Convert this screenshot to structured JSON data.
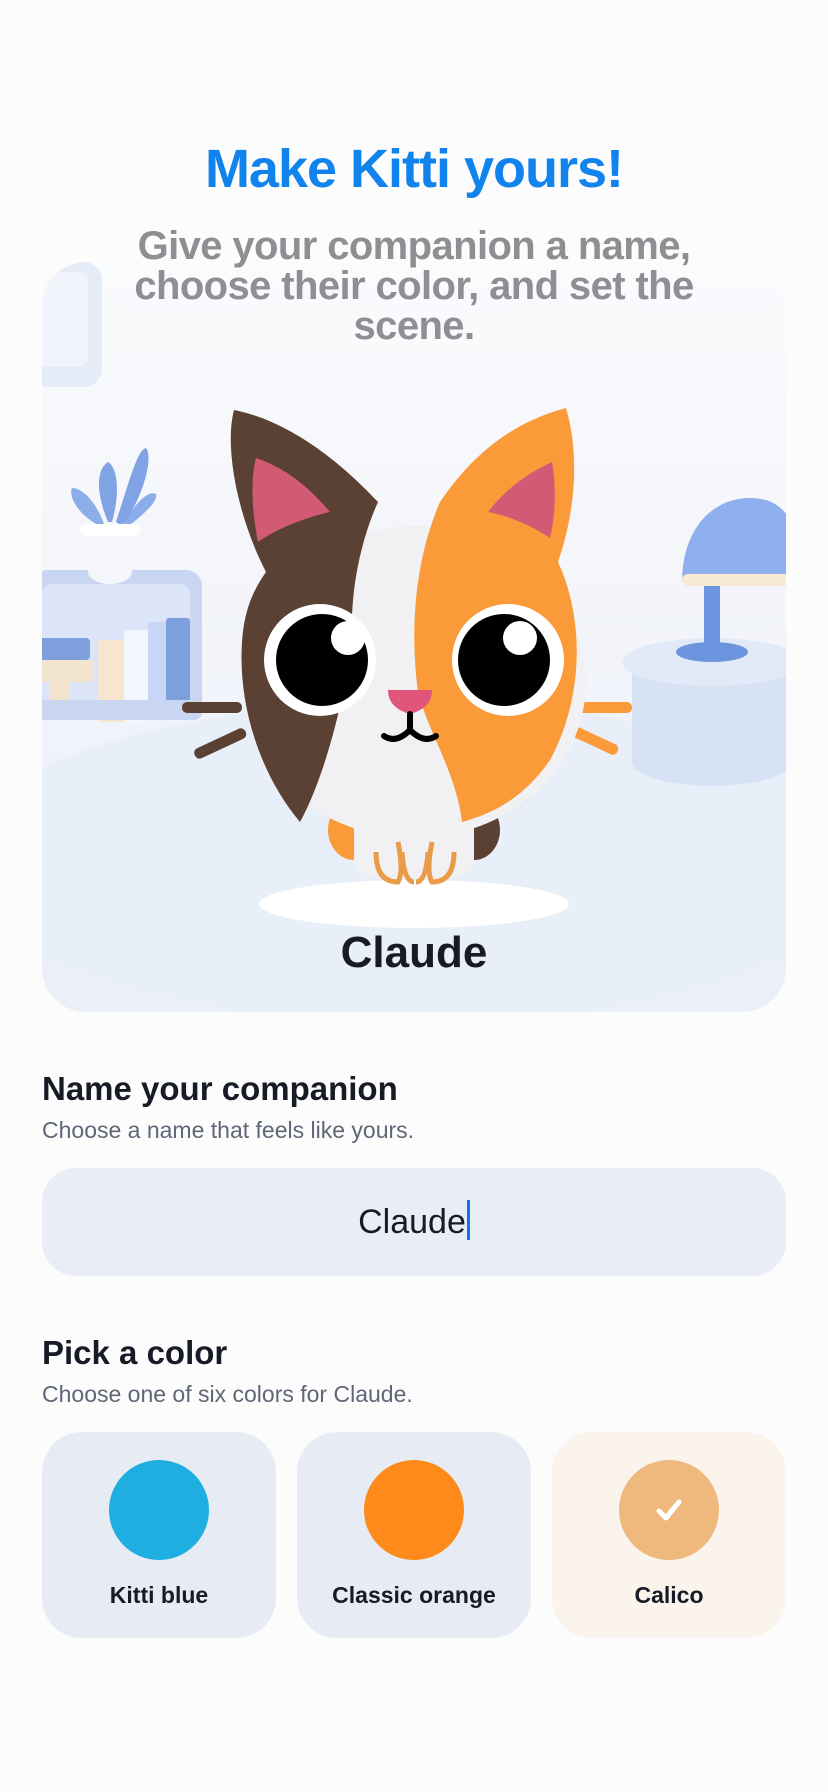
{
  "header": {
    "title": "Make Kitti yours!",
    "subtitle": "Give your companion a name, choose their color, and set the scene."
  },
  "preview": {
    "companion_name": "Claude"
  },
  "name_section": {
    "title": "Name your companion",
    "subtitle": "Choose a name that feels like yours.",
    "input_value": "Claude"
  },
  "color_section": {
    "title": "Pick a color",
    "subtitle": "Choose one of six colors for Claude.",
    "options": [
      {
        "label": "Kitti blue",
        "color": "#1faee0",
        "selected": false
      },
      {
        "label": "Classic orange",
        "color": "#fd8a1a",
        "selected": false
      },
      {
        "label": "Calico",
        "color": "#efb87c",
        "selected": true
      }
    ]
  },
  "colors": {
    "accent": "#1183ec",
    "text_primary": "#161b26",
    "text_secondary": "#5f6676"
  }
}
